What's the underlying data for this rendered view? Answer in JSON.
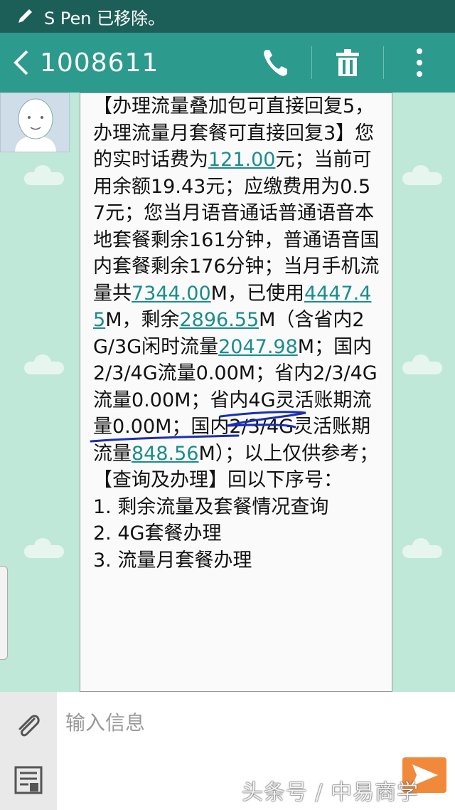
{
  "status_bar": {
    "notification": "S Pen 已移除。"
  },
  "header": {
    "contact": "1008611",
    "icons": [
      "back-icon",
      "phone-icon",
      "delete-icon",
      "more-icon"
    ]
  },
  "message": {
    "seg1": "【办理流量叠加包可直接回复5，办理流量月套餐可直接回复3】您的实时话费为",
    "link1": "121.00",
    "seg2": "元；当前可用余额19.43元；应缴费用为0.57元；您当月语音通话普通语音本地套餐剩余161分钟，普通语音国内套餐剩余176分钟；当月手机流量共",
    "link2": "7344.00",
    "seg3": "M，已使用",
    "link3": "4447.45",
    "seg4": "M，剩余",
    "link4": "2896.55",
    "seg5": "M（含省内2G/3G闲时流量",
    "link5": "2047.98",
    "seg6": "M；国内2/3/4G流量0.00M；省内2/3/4G流量0.00M；省内4G灵活账期流量0.00M；国内2/3/4G灵活账期流量",
    "link6": "848.56",
    "seg7": "M）；以上仅供参考；【查询及办理】回以下序号：\n1. 剩余流量及套餐情况查询\n2. 4G套餐办理\n3. 流量月套餐办理"
  },
  "input": {
    "placeholder": "输入信息",
    "icons": [
      "attach-icon",
      "template-icon",
      "send-icon"
    ]
  },
  "watermark": "头条号 / 中易商学",
  "colors": {
    "status_bar": "#1c5f59",
    "app_bar": "#2c9a8d",
    "chat_bg": "#bfe8d8",
    "link": "#1b8c8c",
    "scribble": "#1a2fb0"
  }
}
